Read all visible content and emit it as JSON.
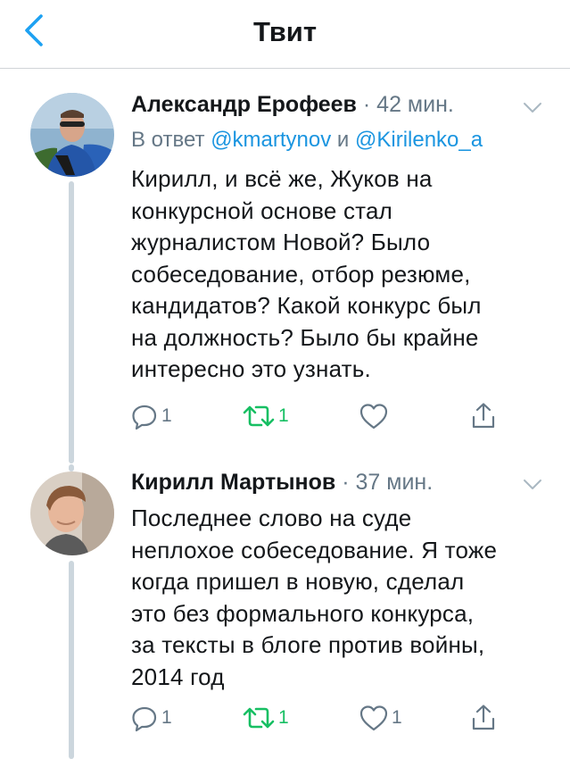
{
  "header": {
    "title": "Твит"
  },
  "tweets": [
    {
      "author": "Александр Ерофеев",
      "separator": "·",
      "time": "42 мин.",
      "reply_prefix": "В ответ",
      "reply_to_1": "@kmartynov",
      "reply_and": "и",
      "reply_to_2": "@Kirilenko_a",
      "text": "Кирилл, и всё же, Жуков на\nконкурсной основе стал\nжурналистом Новой? Было\nсобеседование, отбор резюме,\nкандидатов? Какой конкурс был\nна должность? Было бы крайне\nинтересно это узнать.",
      "replies": "1",
      "retweets": "1",
      "likes": ""
    },
    {
      "author": "Кирилл Мартынов",
      "separator": "·",
      "time": "37 мин.",
      "text": "Последнее слово на суде\nнеплохое собеседование. Я тоже\nкогда пришел в новую,  сделал\nэто без формального конкурса,\nза тексты в блоге против войны,\n2014 год",
      "replies": "1",
      "retweets": "1",
      "likes": "1"
    }
  ],
  "colors": {
    "accent": "#1da1f2",
    "mention": "#1b95e0",
    "retweet": "#17bf63",
    "muted": "#657786",
    "thread": "#ccd6dd"
  },
  "icons": [
    "back-chevron-icon",
    "chevron-down-icon",
    "reply-icon",
    "retweet-icon",
    "like-icon",
    "share-icon"
  ]
}
